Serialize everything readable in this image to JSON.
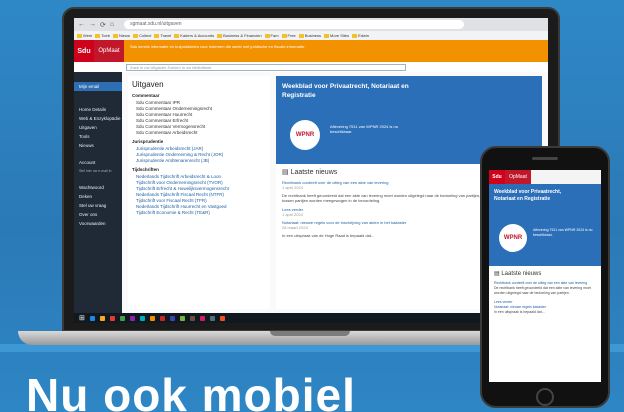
{
  "browser": {
    "url": "sgmaat.sdu.nl/uitgaven",
    "bookmarks": [
      "Werk",
      "Toeb",
      "Nieuw",
      "Collect",
      "Travel",
      "Kaders & Accounts",
      "Business & Financien",
      "Fam",
      "Free",
      "Business",
      "More Sites",
      "Edwin"
    ]
  },
  "app": {
    "brand": "Sdu",
    "product": "OpMaat",
    "banner": "Sdu kennis informatie en hulpmiddelen voor iedereen die werkt met juridische en fiscale informatie.",
    "search_placeholder": "Zoek in uw Uitgaven   Zoeken in uw bibliotheek"
  },
  "sidebar": {
    "items": [
      {
        "label": "Home Details"
      },
      {
        "label": "Web & Enzyklopädie"
      },
      {
        "label": "Uitgaven"
      },
      {
        "label": "Tools"
      },
      {
        "label": "Nieuws"
      }
    ],
    "active": "Mijn email",
    "account_title": "Account",
    "account_sub": "Stel hier uw e-mail in",
    "footer": [
      {
        "label": "Wachtwoord"
      },
      {
        "label": "Deken"
      },
      {
        "label": "Stel uw vraag"
      },
      {
        "label": "Over ons"
      },
      {
        "label": "Voorwaarden"
      }
    ]
  },
  "uitgaven": {
    "title": "Uitgaven",
    "sections": [
      {
        "title": "Commentaar",
        "links": [
          "Sdu Commentaar IPR",
          "Sdu Commentaar Ondernemingsrecht",
          "Sdu Commentaar Huurrecht",
          "Sdu Commentaar Erfrecht",
          "Sdu Commentaar Vermogensrecht",
          "Sdu Commentaar Arbeidsrecht"
        ]
      },
      {
        "title": "Jurisprudentie",
        "links": [
          "Jurisprudentie Arbeidsrecht (JAR)",
          "Jurisprudentie Onderneming & Recht (JOR)",
          "Jurisprudentie Ambtenarenrecht (JB)"
        ]
      },
      {
        "title": "Tijdschriften",
        "links": [
          "Nederlands Tijdschrift Arbeidsrecht & Loon",
          "Tijdschrift voor Ondernemingsrecht (TVOR)",
          "Tijdschrift Erfrecht & Huwelijksvermogensrecht",
          "Nederlands Tijdschrift Fiscaal Recht (NTFR)",
          "Tijdschrift voor Fiscaal Recht (TFR)",
          "Nederlands Tijdschrift Huurrecht en Vastgoed",
          "Tijdschrift Economie & Recht (TE&R)"
        ]
      }
    ]
  },
  "hero": {
    "title": "Weekblad voor Privaatrecht, Notariaat en Registratie",
    "logo": "WPNR",
    "text": "Aflevering 7511 van WPNR 2024 is nu beschikbaar."
  },
  "news": {
    "title": "Laatste nieuws",
    "items": [
      {
        "link": "Rechtbank oordeelt over de uitleg van een akte van levering",
        "date": "1 april 2024",
        "text": "De rechtbank heeft geoordeeld dat een akte van levering moet worden uitgelegd naar de bedoeling van partijen, waarbij ook de verhoudingen tussen partijen worden meegewogen in de beoordeling."
      },
      {
        "link": "Lees verder",
        "date": "1 april 2024",
        "text": ""
      },
      {
        "link": "Notariaat: nieuwe regels voor de inschrijving van akten in het kadaster",
        "date": "28 maart 2024",
        "text": "In een uitspraak van de Hoge Raad is bepaald dat..."
      }
    ]
  },
  "phone": {
    "brand": "Sdu",
    "product": "OpMaat",
    "hero_title": "Weekblad voor Privaatrecht, Notariaat en Registratie",
    "logo": "WPNR",
    "hero_text": "Aflevering 7511 van WPNR 2024 is nu beschikbaar.",
    "news_title": "Laatste nieuws",
    "news": [
      {
        "link": "Rechtbank oordeelt over de uitleg van een akte van levering",
        "text": "De rechtbank heeft geoordeeld dat een akte van levering moet worden uitgelegd naar de bedoeling van partijen."
      },
      {
        "link": "Lees verder",
        "text": ""
      },
      {
        "link": "Notariaat: nieuwe regels kadaster",
        "text": "In een uitspraak is bepaald dat..."
      }
    ]
  },
  "headline": "Nu ook mobiel",
  "taskbar_colors": [
    "#1e88e5",
    "#f9a825",
    "#e53935",
    "#43a047",
    "#8e24aa",
    "#00acc1",
    "#fb8c00",
    "#c62828",
    "#3949ab",
    "#7cb342",
    "#6d4c41",
    "#d81b60",
    "#546e7a",
    "#f4511e"
  ]
}
